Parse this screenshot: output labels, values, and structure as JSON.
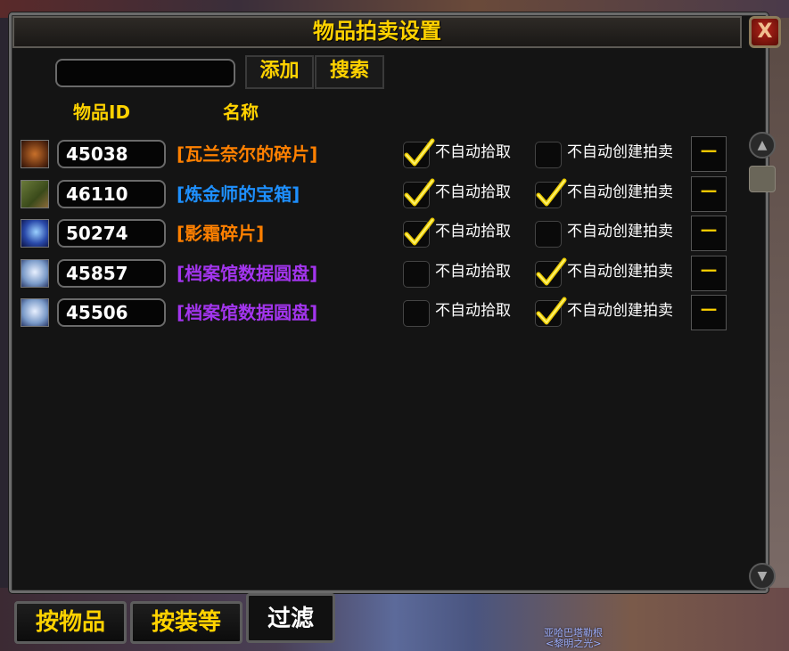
{
  "window": {
    "title": "物品拍卖设置",
    "close_label": "X"
  },
  "search": {
    "value": "",
    "add_label": "添加",
    "search_label": "搜索"
  },
  "columns": {
    "id": "物品ID",
    "name": "名称"
  },
  "rows": [
    {
      "id": "45038",
      "name": "[瓦兰奈尔的碎片]",
      "color": "#ff8000",
      "icon": "treasure-chest-icon",
      "no_auto_loot": true,
      "no_auto_auction": false
    },
    {
      "id": "46110",
      "name": "[炼金师的宝箱]",
      "color": "#1e90ff",
      "icon": "alchemist-chest-icon",
      "no_auto_loot": true,
      "no_auto_auction": true
    },
    {
      "id": "50274",
      "name": "[影霜碎片]",
      "color": "#ff8000",
      "icon": "shadowfrost-shard-icon",
      "no_auto_loot": true,
      "no_auto_auction": false
    },
    {
      "id": "45857",
      "name": "[档案馆数据圆盘]",
      "color": "#a335ee",
      "icon": "archivum-disc-icon",
      "no_auto_loot": false,
      "no_auto_auction": true
    },
    {
      "id": "45506",
      "name": "[档案馆数据圆盘]",
      "color": "#a335ee",
      "icon": "archivum-disc-icon",
      "no_auto_loot": false,
      "no_auto_auction": true
    }
  ],
  "labels": {
    "no_auto_loot": "不自动拾取",
    "no_auto_auction": "不自动创建拍卖",
    "remove": "－"
  },
  "tabs": [
    {
      "label": "按物品",
      "active": false
    },
    {
      "label": "按装等",
      "active": false
    },
    {
      "label": "过滤",
      "active": true
    }
  ],
  "scene": {
    "npc_name": "亚哈巴塔勒根",
    "npc_title": "<黎明之光>"
  }
}
